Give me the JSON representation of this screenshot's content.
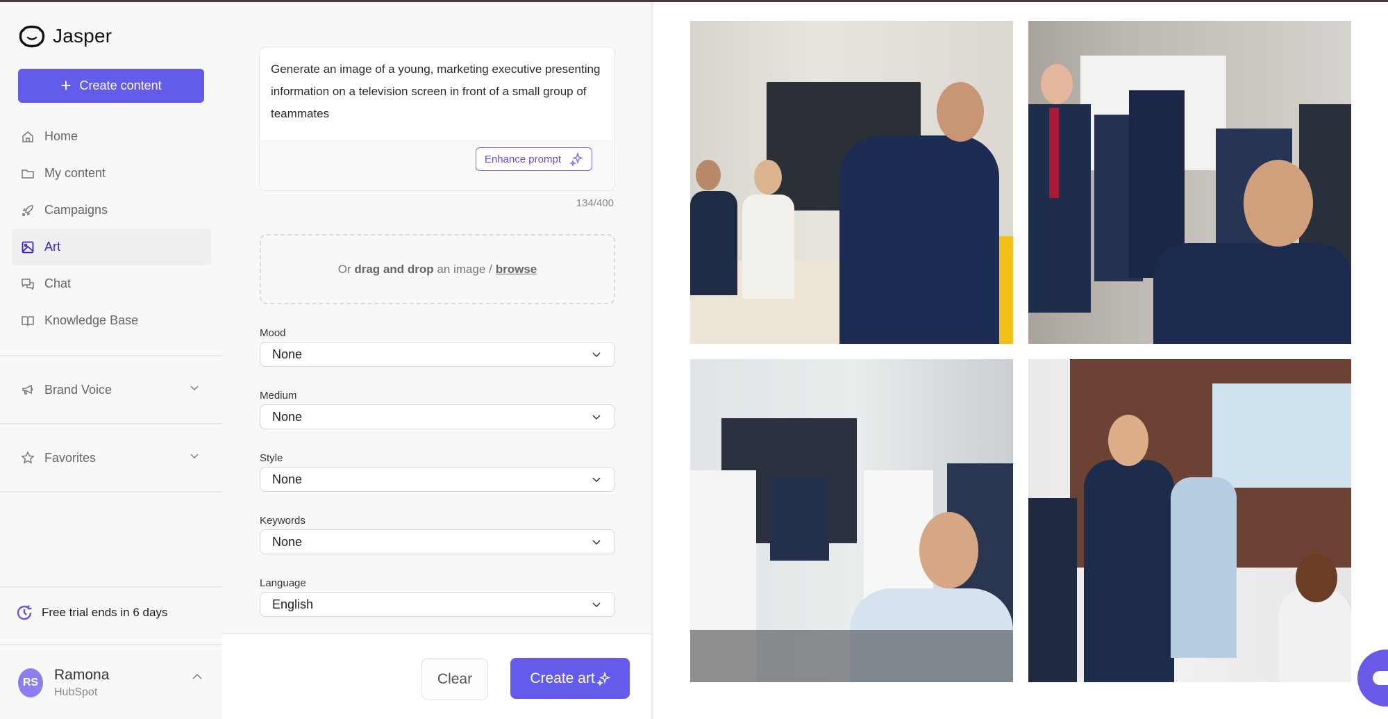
{
  "app": {
    "name": "Jasper",
    "brand_color": "#635bea",
    "logo_icon": "jasper-face-icon"
  },
  "sidebar": {
    "create_button": {
      "label": "Create content",
      "icon": "plus-icon"
    },
    "nav": [
      {
        "label": "Home",
        "icon": "home-icon",
        "active": false
      },
      {
        "label": "My content",
        "icon": "folder-icon",
        "active": false
      },
      {
        "label": "Campaigns",
        "icon": "rocket-icon",
        "active": false
      },
      {
        "label": "Art",
        "icon": "image-icon",
        "active": true
      },
      {
        "label": "Chat",
        "icon": "chat-icon",
        "active": false
      },
      {
        "label": "Knowledge Base",
        "icon": "book-icon",
        "active": false
      }
    ],
    "sections": [
      {
        "label": "Brand Voice",
        "icon": "megaphone-icon",
        "expanded": false
      },
      {
        "label": "Favorites",
        "icon": "star-icon",
        "expanded": false
      }
    ],
    "trial": {
      "text": "Free trial ends in 6 days",
      "icon": "clock-refresh-icon"
    },
    "user": {
      "initials": "RS",
      "name": "Ramona",
      "org": "HubSpot",
      "avatar_color": "#8b7ff0"
    }
  },
  "form": {
    "prompt": {
      "value": "Generate an image of a young, marketing executive presenting information on a television screen in front of a small group of teammates",
      "counter": "134/400",
      "enhance_label": "Enhance prompt"
    },
    "dropzone": {
      "prefix": "Or",
      "bold": "drag and drop",
      "middle": "an image /",
      "link": "browse"
    },
    "fields": [
      {
        "label": "Mood",
        "value": "None"
      },
      {
        "label": "Medium",
        "value": "None"
      },
      {
        "label": "Style",
        "value": "None"
      },
      {
        "label": "Keywords",
        "value": "None"
      },
      {
        "label": "Language",
        "value": "English"
      }
    ],
    "buttons": {
      "clear": "Clear",
      "create": "Create art"
    }
  },
  "results": {
    "images": [
      {
        "description": "Presenter in navy suit gesturing at wall TV, two teammates seated on bench"
      },
      {
        "description": "Smiling man raising finger in front of group of colleagues near a screen"
      },
      {
        "description": "Team meeting with colleagues standing, man smiling at center-right"
      },
      {
        "description": "Man in blazer standing before a TV showing a presenter, colleagues watching"
      }
    ]
  },
  "chat_widget": {
    "icon": "chat-bubble-icon"
  }
}
